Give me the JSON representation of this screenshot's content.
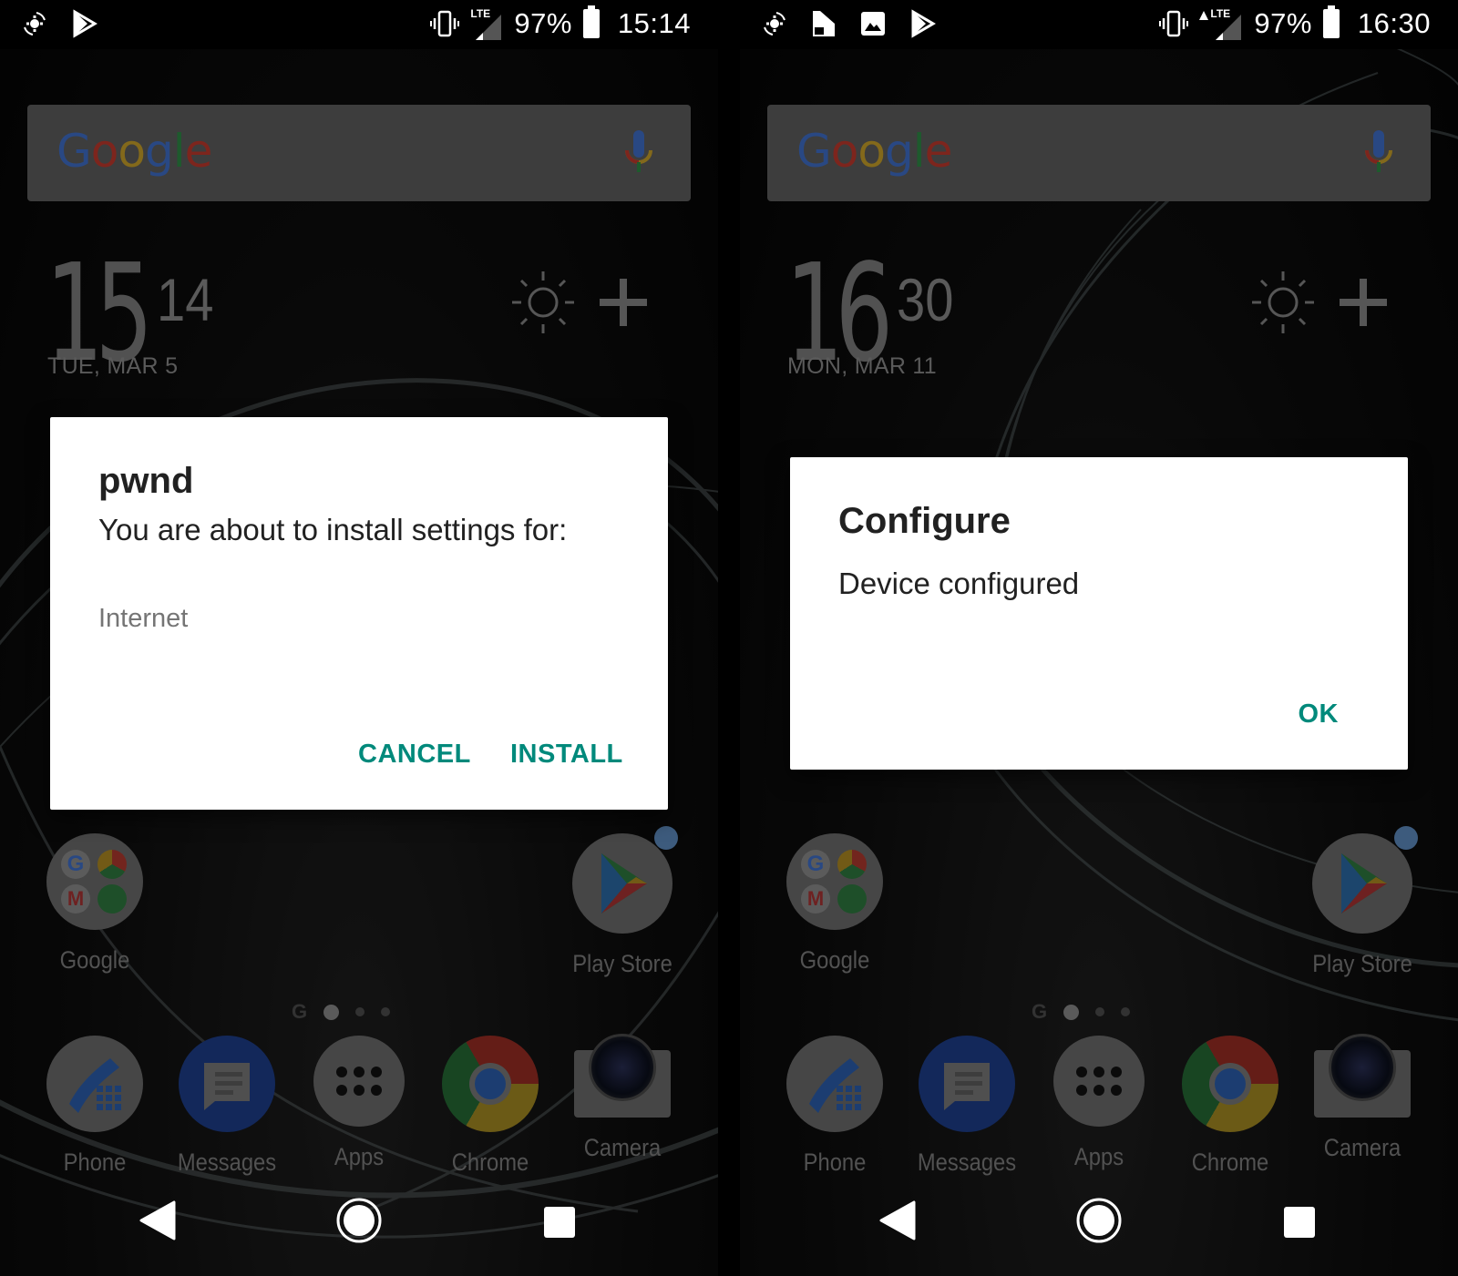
{
  "screens": [
    {
      "id": "left",
      "status_bar": {
        "notification_icons": [
          "sync-settings-icon",
          "play-store-icon"
        ],
        "vibrate_icon": "vibrate-icon",
        "network_label": "LTE",
        "signal_icon": "signal-icon",
        "battery_percent": "97%",
        "battery_icon": "battery-icon",
        "time": "15:14"
      },
      "search_bar": {
        "logo_text": "Google",
        "mic_icon": "mic-icon"
      },
      "clock": {
        "hour": "15",
        "minute": "14",
        "date": "TUE, MAR 5"
      },
      "weather": {
        "icon": "sun-icon",
        "add_icon": "plus-icon"
      },
      "dialog": {
        "title": "pwnd",
        "message": "You are about to install settings for:",
        "item": "Internet",
        "buttons": [
          "CANCEL",
          "INSTALL"
        ]
      }
    },
    {
      "id": "right",
      "status_bar": {
        "notification_icons": [
          "sync-settings-icon",
          "sim-card-icon",
          "image-icon",
          "play-store-icon"
        ],
        "vibrate_icon": "vibrate-icon",
        "network_label": "LTE",
        "signal_icon": "signal-icon",
        "battery_percent": "97%",
        "battery_icon": "battery-icon",
        "time": "16:30"
      },
      "search_bar": {
        "logo_text": "Google",
        "mic_icon": "mic-icon"
      },
      "clock": {
        "hour": "16",
        "minute": "30",
        "date": "MON, MAR 11"
      },
      "weather": {
        "icon": "sun-icon",
        "add_icon": "plus-icon"
      },
      "dialog": {
        "title": "Configure",
        "message": "Device configured",
        "buttons": [
          "OK"
        ]
      }
    }
  ],
  "home": {
    "top_row": [
      {
        "label": "Google",
        "icon": "google-folder-icon"
      },
      {
        "label": "Play Store",
        "icon": "play-store-icon",
        "has_badge": true
      }
    ],
    "page_indicator": {
      "google_label": "G",
      "pages": 3,
      "active_page": 1
    },
    "dock": [
      {
        "label": "Phone",
        "icon": "phone-icon"
      },
      {
        "label": "Messages",
        "icon": "messages-icon"
      },
      {
        "label": "Apps",
        "icon": "apps-icon"
      },
      {
        "label": "Chrome",
        "icon": "chrome-icon"
      },
      {
        "label": "Camera",
        "icon": "camera-icon"
      }
    ],
    "nav": [
      "back",
      "home",
      "recents"
    ]
  },
  "colors": {
    "accent": "#00897b",
    "google_blue": "#4285f4",
    "google_red": "#ea4335",
    "google_yellow": "#fbbc05",
    "google_green": "#34a853"
  }
}
